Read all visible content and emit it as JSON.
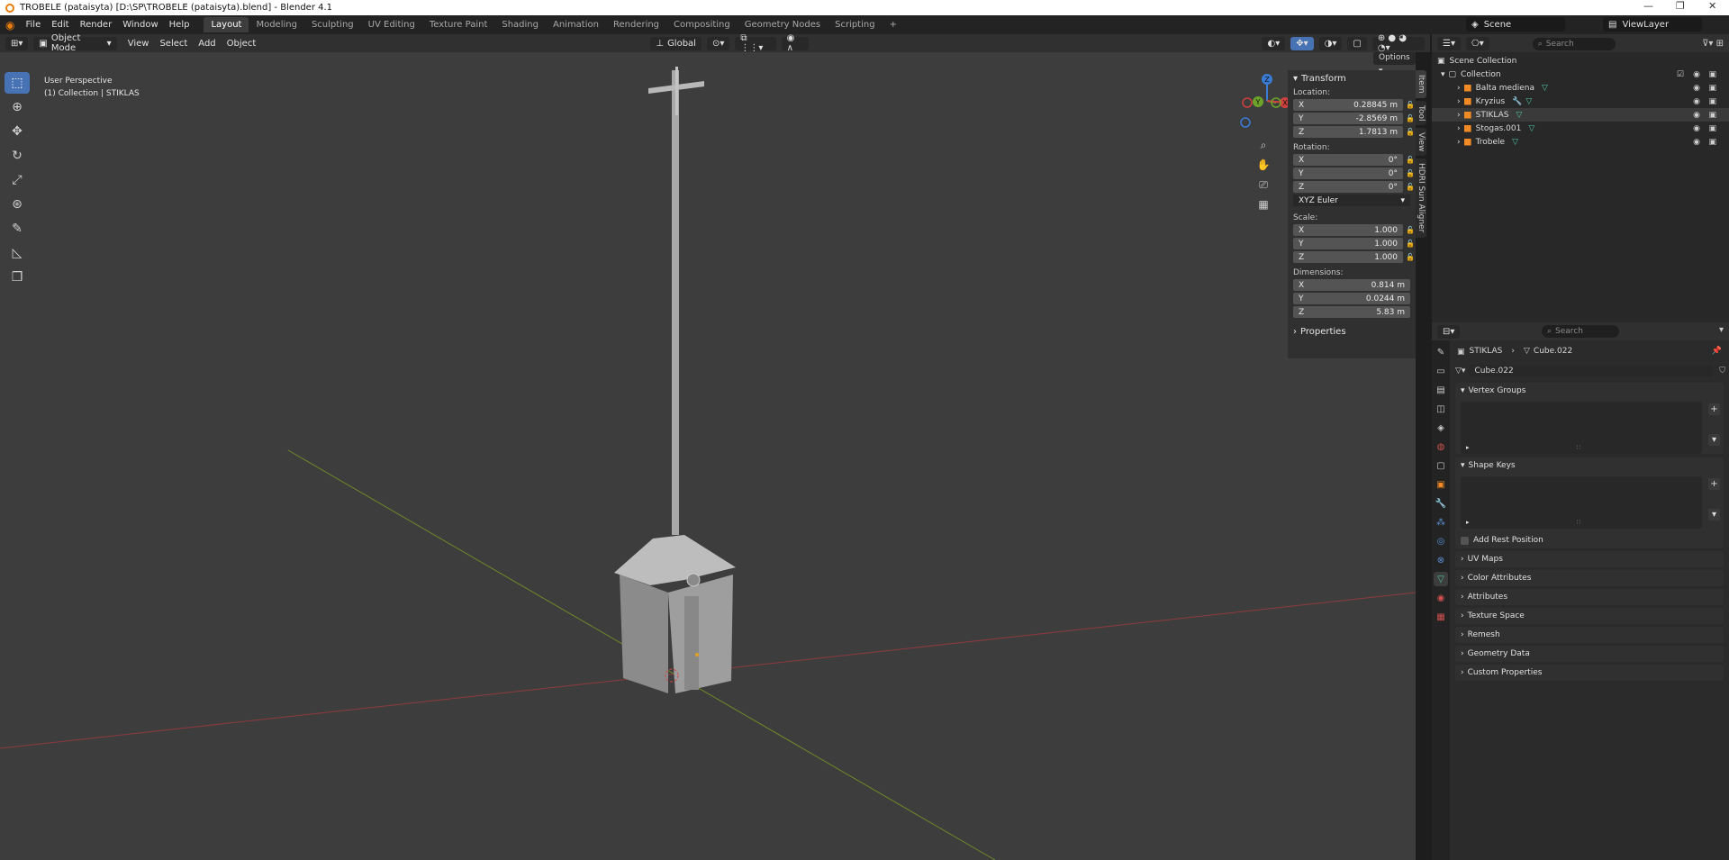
{
  "window": {
    "title": "TROBELE (pataisyta) [D:\\SP\\TROBELE (pataisyta).blend] - Blender 4.1"
  },
  "menu": [
    "File",
    "Edit",
    "Render",
    "Window",
    "Help"
  ],
  "workspaces": [
    "Layout",
    "Modeling",
    "Sculpting",
    "UV Editing",
    "Texture Paint",
    "Shading",
    "Animation",
    "Rendering",
    "Compositing",
    "Geometry Nodes",
    "Scripting",
    "+"
  ],
  "active_workspace": "Layout",
  "scene": "Scene",
  "view_layer": "ViewLayer",
  "viewport_header": {
    "mode": "Object Mode",
    "menus": [
      "View",
      "Select",
      "Add",
      "Object"
    ],
    "transform_orientation": "Global",
    "options_label": "Options"
  },
  "viewport": {
    "perspective": "User Perspective",
    "collection_info": "(1) Collection | STIKLAS"
  },
  "gizmo": {
    "z": "Z",
    "y": "Y",
    "x": "X"
  },
  "n_panel": {
    "header": "Transform",
    "location_label": "Location:",
    "location": {
      "x": "0.28845 m",
      "y": "-2.8569 m",
      "z": "1.7813 m"
    },
    "rotation_label": "Rotation:",
    "rotation": {
      "x": "0°",
      "y": "0°",
      "z": "0°"
    },
    "rotation_mode": "XYZ Euler",
    "scale_label": "Scale:",
    "scale": {
      "x": "1.000",
      "y": "1.000",
      "z": "1.000"
    },
    "dimensions_label": "Dimensions:",
    "dimensions": {
      "x": "0.814 m",
      "y": "0.0244 m",
      "z": "5.83 m"
    },
    "properties_label": "Properties"
  },
  "side_tabs": [
    "Item",
    "Tool",
    "View",
    "HDRI Sun Aligner"
  ],
  "outliner": {
    "search_placeholder": "Search",
    "scene_collection": "Scene Collection",
    "collection": "Collection",
    "items": [
      "Balta mediena",
      "Kryzius",
      "STIKLAS",
      "Stogas.001",
      "Trobele"
    ]
  },
  "properties": {
    "search_placeholder": "Search",
    "breadcrumb_object": "STIKLAS",
    "breadcrumb_mesh": "Cube.022",
    "mesh_name": "Cube.022",
    "sections": {
      "vertex_groups": "Vertex Groups",
      "shape_keys": "Shape Keys",
      "add_rest_position": "Add Rest Position",
      "collapsed": [
        "UV Maps",
        "Color Attributes",
        "Attributes",
        "Texture Space",
        "Remesh",
        "Geometry Data",
        "Custom Properties"
      ]
    }
  },
  "colors": {
    "accent": "#4772b3",
    "axis_x": "#8e3a3f",
    "axis_y": "#6f8a2a",
    "mesh_icon": "#4ec4a6",
    "object_icon": "#f08a24"
  }
}
